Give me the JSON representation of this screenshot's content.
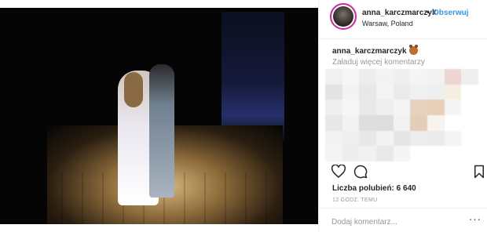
{
  "post": {
    "media_alt_icon": "dancing-couple-photo"
  },
  "header": {
    "username": "anna_karczmarczyk",
    "separator": "•",
    "follow_label": "Obserwuj",
    "location": "Warsaw, Poland"
  },
  "caption": {
    "username": "anna_karczmarczyk",
    "emoji_icon": "bear-face-icon"
  },
  "comments": {
    "load_more": "Załaduj więcej komentarzy"
  },
  "actions": {
    "like_icon": "heart-icon",
    "comment_icon": "speech-bubble-icon",
    "save_icon": "bookmark-icon"
  },
  "likes": {
    "text": "Liczba polubień: 6 640"
  },
  "time": {
    "text": "12 GODZ. TEMU"
  },
  "comment_box": {
    "placeholder": "Dodaj komentarz...",
    "more_label": "···"
  },
  "colors": {
    "accent_link": "#3897f0",
    "text_primary": "#262626",
    "text_secondary": "#999999",
    "border": "#efefef"
  }
}
